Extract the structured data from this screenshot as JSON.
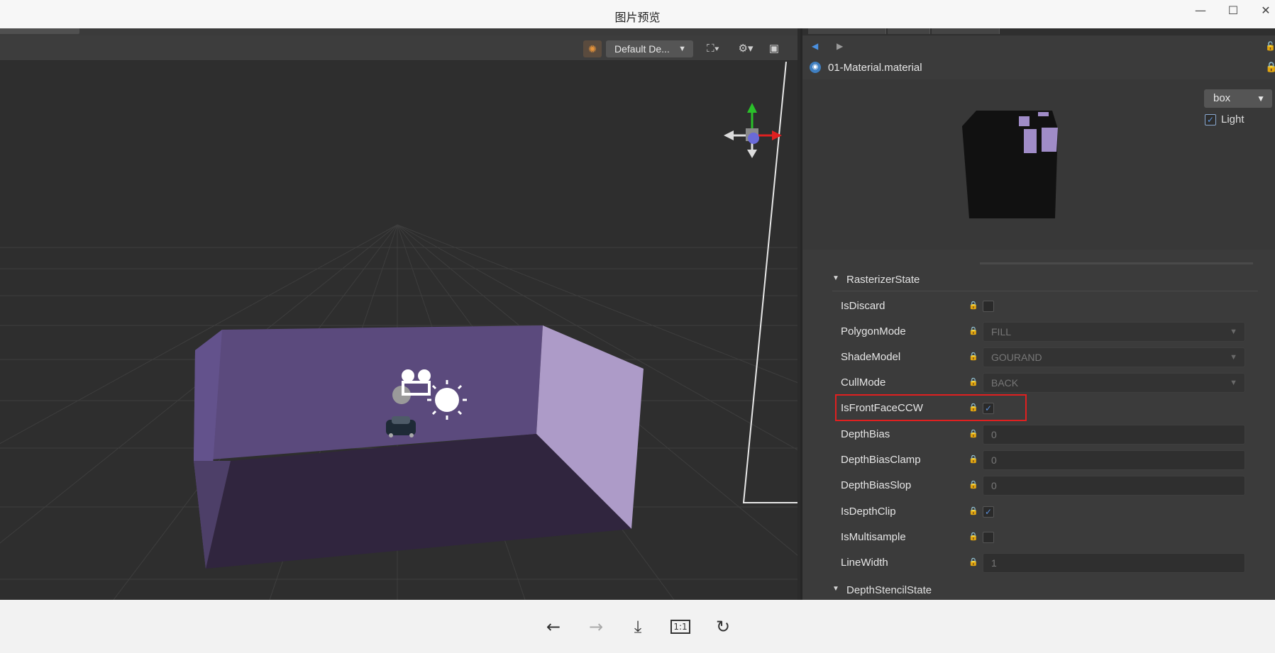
{
  "window": {
    "title": "图片预览",
    "minimize_glyph": "—",
    "maximize_glyph": "☐",
    "close_glyph": "✕"
  },
  "scene": {
    "toolbar": {
      "sun_icon": "sun-icon",
      "device_select": "Default De...",
      "device_arrow": "▼",
      "camera_icon": "camera-icon",
      "settings_icon": "gear-icon",
      "layout_icon": "layout-icon"
    }
  },
  "inspector": {
    "asset_name": "01-Material.material",
    "preview": {
      "mesh_select": "box",
      "light_label": "Light",
      "light_checked": true
    },
    "sections": [
      {
        "label": "RasterizerState"
      },
      {
        "label": "DepthStencilState"
      }
    ],
    "properties": [
      {
        "label": "IsDiscard",
        "type": "checkbox",
        "checked": false
      },
      {
        "label": "PolygonMode",
        "type": "select",
        "value": "FILL"
      },
      {
        "label": "ShadeModel",
        "type": "select",
        "value": "GOURAND"
      },
      {
        "label": "CullMode",
        "type": "select",
        "value": "BACK"
      },
      {
        "label": "IsFrontFaceCCW",
        "type": "checkbox",
        "checked": true
      },
      {
        "label": "DepthBias",
        "type": "number",
        "value": "0"
      },
      {
        "label": "DepthBiasClamp",
        "type": "number",
        "value": "0"
      },
      {
        "label": "DepthBiasSlop",
        "type": "number",
        "value": "0"
      },
      {
        "label": "IsDepthClip",
        "type": "checkbox",
        "checked": true
      },
      {
        "label": "IsMultisample",
        "type": "checkbox",
        "checked": false
      },
      {
        "label": "LineWidth",
        "type": "number",
        "value": "1"
      }
    ]
  },
  "viewer_toolbar": {
    "prev": "←",
    "next": "→",
    "download": "⤓",
    "actual_size": "1:1",
    "rotate": "↻"
  },
  "colors": {
    "scene_bg": "#2e2e2e",
    "wall_back": "#5b4a7d",
    "wall_left": "#63528c",
    "wall_right": "#ad9bc8",
    "floor": "#30253e",
    "highlight": "#e02020"
  }
}
